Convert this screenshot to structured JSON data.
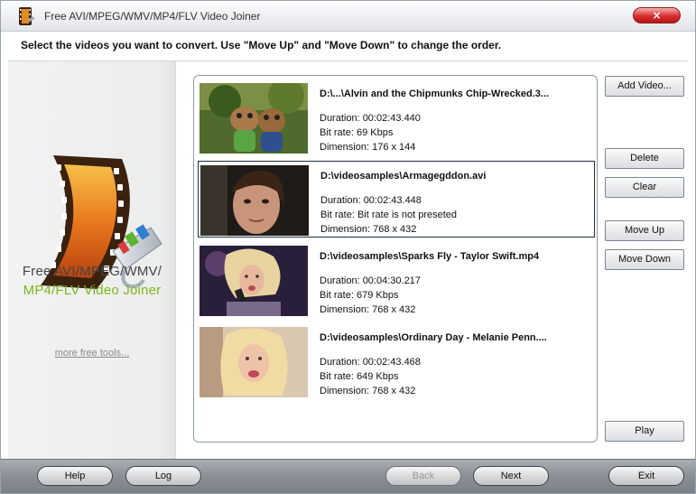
{
  "window": {
    "title": "Free AVI/MPEG/WMV/MP4/FLV Video Joiner",
    "close_label": "×"
  },
  "instruction": "Select the videos you want to convert. Use \"Move Up\" and \"Move Down\" to change the order.",
  "left_panel": {
    "brand_line1": "Free AVI/MPEG/WMV/",
    "brand_line2": "MP4/FLV Video Joiner",
    "more_tools_link": "more free tools..."
  },
  "videos": [
    {
      "path": "D:\\...\\Alvin and the Chipmunks Chip-Wrecked.3...",
      "duration": "Duration: 00:02:43.440",
      "bitrate": "Bit rate: 69 Kbps",
      "dimension": "Dimension: 176 x 144",
      "selected": false
    },
    {
      "path": "D:\\videosamples\\Armagegddon.avi",
      "duration": "Duration: 00:02:43.448",
      "bitrate": "Bit rate: Bit rate is not preseted",
      "dimension": "Dimension: 768 x 432",
      "selected": true
    },
    {
      "path": "D:\\videosamples\\Sparks Fly - Taylor Swift.mp4",
      "duration": "Duration: 00:04:30.217",
      "bitrate": "Bit rate: 679 Kbps",
      "dimension": "Dimension: 768 x 432",
      "selected": false
    },
    {
      "path": "D:\\videosamples\\Ordinary Day - Melanie Penn....",
      "duration": "Duration: 00:02:43.468",
      "bitrate": "Bit rate: 649 Kbps",
      "dimension": "Dimension: 768 x 432",
      "selected": false
    }
  ],
  "buttons": {
    "add_video": "Add Video...",
    "delete": "Delete",
    "clear": "Clear",
    "move_up": "Move Up",
    "move_down": "Move Down",
    "play": "Play"
  },
  "bottom": {
    "help": "Help",
    "log": "Log",
    "back": "Back",
    "next": "Next",
    "exit": "Exit",
    "back_enabled": false
  },
  "colors": {
    "brand_green": "#7cb81a",
    "close_red": "#d72d2d",
    "selection_border": "#1f2d3d"
  }
}
